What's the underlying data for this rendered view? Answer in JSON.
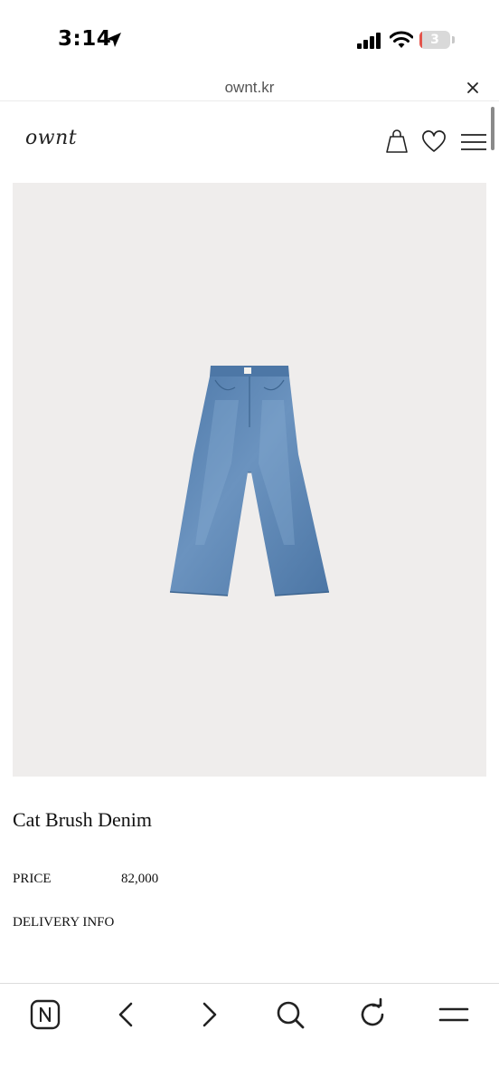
{
  "status_bar": {
    "time": "3:14",
    "battery_level": "3",
    "battery_fraction": 0.03
  },
  "browser": {
    "url": "ownt.kr"
  },
  "site": {
    "logo": "ownt"
  },
  "product": {
    "name": "Cat Brush Denim",
    "price_label": "PRICE",
    "price_value": "82,000",
    "delivery_label": "DELIVERY INFO"
  },
  "colors": {
    "image_background": "#efedec",
    "denim": "#5b86b5",
    "battery_low": "#e4544b"
  },
  "icons": {
    "status": [
      "location-arrow-icon",
      "cellular-signal-icon",
      "wifi-icon",
      "battery-icon"
    ],
    "header": [
      "shopping-bag-icon",
      "heart-icon",
      "hamburger-menu-icon"
    ],
    "toolbar": [
      "naver-home-icon",
      "back-arrow-icon",
      "forward-arrow-icon",
      "search-icon",
      "refresh-icon",
      "menu-icon"
    ]
  }
}
